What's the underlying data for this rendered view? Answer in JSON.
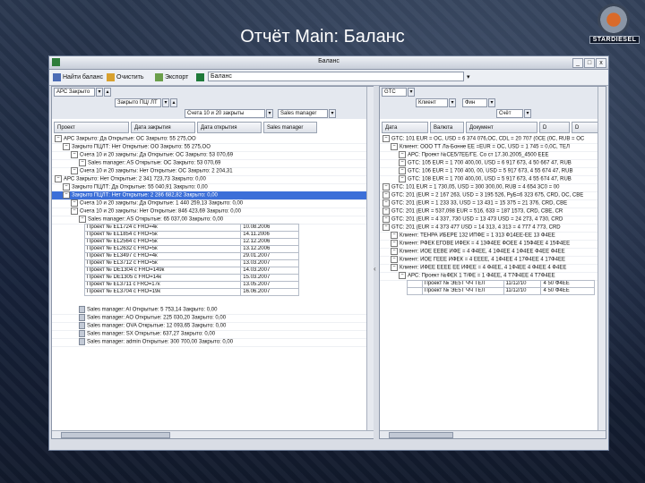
{
  "slide": {
    "title": "Отчёт Main: Баланс"
  },
  "logo": {
    "text": "STARDIESEL"
  },
  "window": {
    "title": "Баланс",
    "controls": [
      "_",
      "□",
      "x"
    ]
  },
  "toolbar": {
    "btn1": "Найти баланс",
    "btn2": "Очистить",
    "btn3": "Экспорт",
    "btn4": "Баланс",
    "search_placeholder": ""
  },
  "left": {
    "filters": {
      "f1": "АРС Закрыто",
      "f2": "Закрыто ПЦ/ ЛТ",
      "f3": "Счета 10 и 20 закрыты",
      "f4": "Sales manager"
    },
    "columns": [
      "Проект",
      "Дата закрытия",
      "Дата открытия",
      "Sales manager"
    ],
    "rows": [
      {
        "level": 0,
        "text": "АРС Закрыто: Да Открытые: ОС Закрыто: 55 275,ОО",
        "sel": false
      },
      {
        "level": 1,
        "text": "Закрыто ПЦЛТ: Нет Открытые: ОО Закрыто: 55 275,ОО",
        "sel": false
      },
      {
        "level": 2,
        "text": "Счета 10 и 20 закрыты: Да Открытые: ОС Закрыто: 53 070,69",
        "sel": false
      },
      {
        "level": 3,
        "text": "Sales manager: AS Открытые: ОС Закрыто: 53 070,69",
        "sel": false
      },
      {
        "level": 2,
        "text": "Счета 10 и 20 закрыты: Нет Открытые: ОС Закрыто: 2 204,31",
        "sel": false
      },
      {
        "level": 0,
        "text": "АРС Закрыто: Нет Открытые: 2 341 723,73 Закрыто: 0,00",
        "sel": false
      },
      {
        "level": 1,
        "text": "Закрыто ПЦЛТ: Да Открытые: 55 040,91 Закрыто: 0,00",
        "sel": false
      },
      {
        "level": 1,
        "text": "Закрыто ПЦЛТ: Нет Открытые: 2 286 682,82 Закрыто: 0,00",
        "sel": true
      },
      {
        "level": 2,
        "text": "Счета 10 и 20 закрыты: Да Открытые: 1 440 259,13 Закрыто: 0,00",
        "sel": false
      },
      {
        "level": 2,
        "text": "Счета 10 и 20 закрыты: Нет Открытые: 846 423,69 Закрыто: 0,00",
        "sel": false
      },
      {
        "level": 3,
        "text": "Sales manager: AS Открытые: 65 037,00 Закрыто: 0,00",
        "sel": false
      }
    ],
    "detail": [
      [
        "Проект № EL1724 с FRO=4к",
        "10.08.2006"
      ],
      [
        "Проект № EL1854 с FRO=5к",
        "14.11.2006"
      ],
      [
        "Проект № EL2564 с FRO=5к",
        "12.12.2006"
      ],
      [
        "Проект № EL2632 с FRO=5к",
        "13.12.2006"
      ],
      [
        "Проект № EL3497 с FRO=4к",
        "29.01.2007"
      ],
      [
        "Проект № EL3712 с FRO=5к",
        "13.03.2007"
      ],
      [
        "Проект № DE1304 с FRO=149к",
        "14.03.2007"
      ],
      [
        "Проект № DE1305 с FRO=14к",
        "15.03.2007"
      ],
      [
        "Проект № EL3711 с FRO=17к",
        "13.05.2007"
      ],
      [
        "Проект № EL3704 с FRO=19к",
        "16.06.2007"
      ]
    ],
    "rows_after": [
      "Sales manager: AI Открытые: 5 753,14 Закрыто: 0,00",
      "Sales manager: AO Открытые: 225 030,20 Закрыто: 0,00",
      "Sales manager: OVA Открытые: 12 093,65 Закрыто: 0,00",
      "Sales manager: SX Открытые: 637,27 Закрыто: 0,00",
      "Sales manager: admin Открытые: 300 700,00 Закрыто: 0,00"
    ]
  },
  "right": {
    "filters": {
      "f1": "GTC",
      "f2": "Клиент",
      "f3": "Фин",
      "f4": "Счёт"
    },
    "columns": [
      "Дата",
      "Валюта",
      "Документ",
      "D",
      "D"
    ],
    "rows": [
      {
        "level": 0,
        "text": "GTC: 101 EUR = ОС, USD = 6 374 076,ОС, CDL = 20 707 (0CE (0C, RUB = ОС"
      },
      {
        "level": 1,
        "text": "Клиент: ООО ТТ Ла-Бонне ЕЕ =ЕUR = ОС, USD = 1 745 = 0,0С, ТЕЛ"
      },
      {
        "level": 2,
        "text": "АРС: Проект №СЕ5/7ЕЕ/ГЕ. Со ст 17.30.2005_4500 ЕЕЕ"
      },
      {
        "level": 2,
        "text": "GTC: 105 EUR = 1 700 400,00, USD = 6 917 673, 4 50 667 47, RUB"
      },
      {
        "level": 2,
        "text": "GTC: 106 EUR = 1 700 400, 00, USD = 5 917 673, 4 55 674 47, RUB"
      },
      {
        "level": 2,
        "text": "GTC: 108 EUR = 1 700 400,00, USD = 5 917 673, 4 55 674 47, RUB"
      },
      {
        "level": 0,
        "text": "GTC: 101 EUR = 1 730,05, USD = 300 300,00, RUB = 4 654 3C0 = 00"
      },
      {
        "level": 0,
        "text": "GTC: 201 (EUR = 2 167 263, USD = 3 195 526, РуБ=6 323 675, CRD, ОС, CBE"
      },
      {
        "level": 0,
        "text": "GTC: 201 (EUR = 1 233 33, USD = 13 431 = 15 375 = 21 376, CRD, CBE"
      },
      {
        "level": 0,
        "text": "GTC: 201 (EUR = 537,098 EUR = 516, 633 = 187 1573, CRD, CBE, CR"
      },
      {
        "level": 0,
        "text": "GTC: 201 (EUR = 4 337, 730 USD = 13 473 USD = 24 273, 4 730, CRD"
      },
      {
        "level": 0,
        "text": "GTC: 201 (EUR = 4 373 477 USD = 14 313, 4 313 = 4 777 4 773, CRD"
      },
      {
        "level": 1,
        "text": "Клиент: ТЕНРА ИБЕРЕ 132 ИПФЕ = 1 313 Ф14ЕЕ-ЕЕ 13 Ф4ЕЕ"
      },
      {
        "level": 1,
        "text": "Клиент: РФЕК ЕГОВЕ ИФЕК = 4 13Ф4ЕЕ ФОЕЕ 4 15Ф4ЕЕ 4 15Ф4ЕЕ"
      },
      {
        "level": 1,
        "text": "Клиент: ИОЕ ЕЕВЕ ИФЕ = 4 Ф4ЕЕ, 4 1Ф4ЕЕ 4 1Ф4ЕЕ Ф4ЕЕ Ф4ЕЕ"
      },
      {
        "level": 1,
        "text": "Клиент: ИОЕ ГЕЕЕ ИФЕК = 4 ЕЕЕЕ, 4 1Ф4ЕЕ 4 17Ф4ЕЕ 4 17Ф4ЕЕ"
      },
      {
        "level": 1,
        "text": "Клиент: ИФЕЕ ЕЕЕЕ ЕЕ ИФЕЕ = 4 Ф4ЕЕ, 4 1Ф4ЕЕ 4 Ф4ЕЕ 4 Ф4ЕЕ"
      },
      {
        "level": 2,
        "text": "АРС: Проект №ФЕК 1 Т/ФЕ = 1 Ф4ЕЕ, 4 Т7Ф4ЕЕ 4 Т7Ф4ЕЕ"
      }
    ],
    "detail": [
      [
        "",
        "Проект № ЭЕ5Т ЧЧ ТЕЛ",
        "11/12/10",
        "4 50 Ф4ЕЕ"
      ],
      [
        "",
        "Проект № ЭЕ5Т ЧЧ ТЕЛ",
        "11/12/10",
        "4 50 Ф4ЕЕ"
      ]
    ]
  }
}
